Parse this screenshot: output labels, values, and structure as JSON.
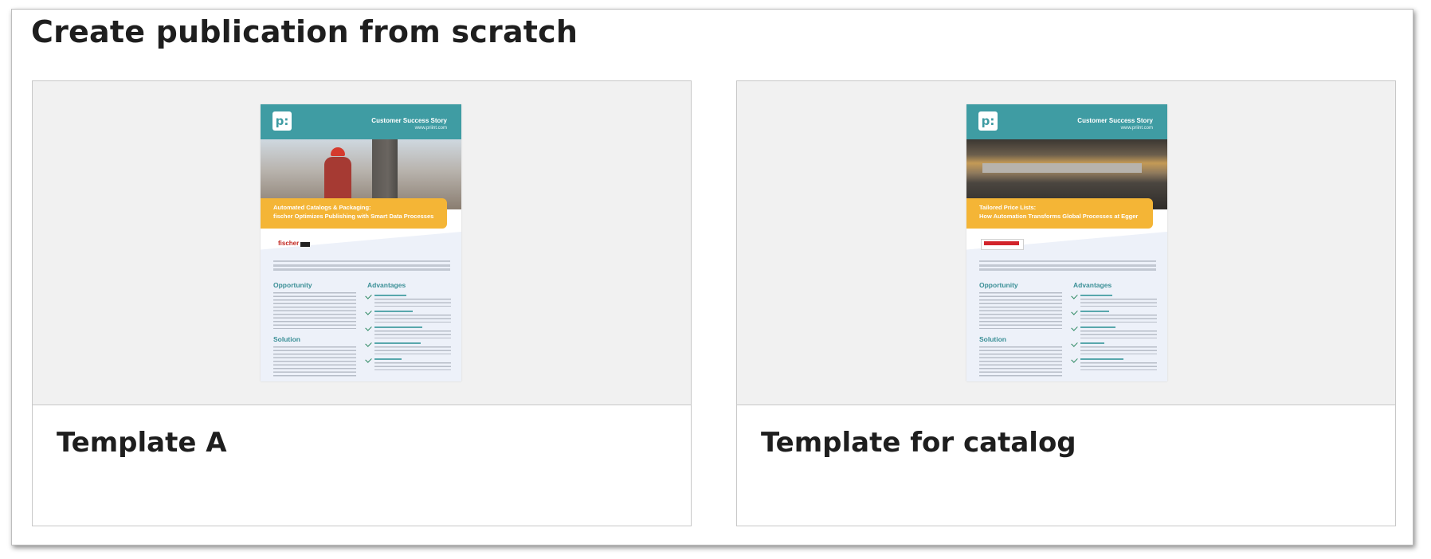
{
  "title": "Create publication from scratch",
  "templates": [
    {
      "label": "Template A",
      "doc": {
        "kicker": "Customer Success Story",
        "site": "www.priint.com",
        "banner_line1": "Automated Catalogs & Packaging:",
        "banner_line2": "fischer Optimizes Publishing with Smart Data Processes",
        "brand": "fischer",
        "left_heading_1": "Opportunity",
        "left_heading_2": "Solution",
        "right_heading": "Advantages"
      }
    },
    {
      "label": "Template for catalog",
      "doc": {
        "kicker": "Customer Success Story",
        "site": "www.priint.com",
        "banner_line1": "Tailored Price Lists:",
        "banner_line2": "How Automation Transforms Global Processes at Egger",
        "left_heading_1": "Opportunity",
        "left_heading_2": "Solution",
        "right_heading": "Advantages"
      }
    }
  ],
  "icons": {
    "logo": "priint-logo-icon",
    "check": "checkmark-icon"
  },
  "colors": {
    "teal": "#3f9ca3",
    "banner_yellow": "#f4b536",
    "preview_bg": "#f1f1f1"
  }
}
